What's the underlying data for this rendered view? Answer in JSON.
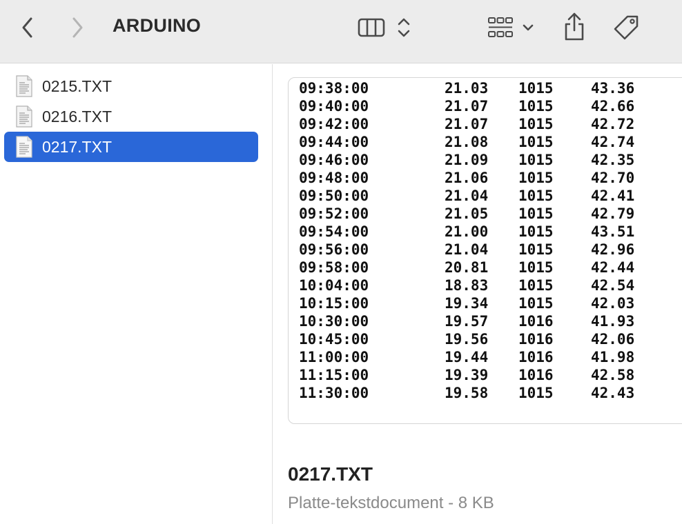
{
  "window": {
    "title": "ARDUINO"
  },
  "toolbar": {
    "icons": [
      "chevron-left-icon",
      "chevron-right-icon",
      "column-view-icon",
      "updown-chevron-icon",
      "grid-icon",
      "chevron-down-icon",
      "share-icon",
      "tag-icon"
    ]
  },
  "sidebar": {
    "files": [
      {
        "name": "0215.TXT",
        "selected": false
      },
      {
        "name": "0216.TXT",
        "selected": false
      },
      {
        "name": "0217.TXT",
        "selected": true
      }
    ]
  },
  "preview": {
    "rows": [
      {
        "time": "09:38:00",
        "temp": "21.03",
        "pressure": "1015",
        "humidity": "43.36"
      },
      {
        "time": "09:40:00",
        "temp": "21.07",
        "pressure": "1015",
        "humidity": "42.66"
      },
      {
        "time": "09:42:00",
        "temp": "21.07",
        "pressure": "1015",
        "humidity": "42.72"
      },
      {
        "time": "09:44:00",
        "temp": "21.08",
        "pressure": "1015",
        "humidity": "42.74"
      },
      {
        "time": "09:46:00",
        "temp": "21.09",
        "pressure": "1015",
        "humidity": "42.35"
      },
      {
        "time": "09:48:00",
        "temp": "21.06",
        "pressure": "1015",
        "humidity": "42.70"
      },
      {
        "time": "09:50:00",
        "temp": "21.04",
        "pressure": "1015",
        "humidity": "42.41"
      },
      {
        "time": "09:52:00",
        "temp": "21.05",
        "pressure": "1015",
        "humidity": "42.79"
      },
      {
        "time": "09:54:00",
        "temp": "21.00",
        "pressure": "1015",
        "humidity": "43.51"
      },
      {
        "time": "09:56:00",
        "temp": "21.04",
        "pressure": "1015",
        "humidity": "42.96"
      },
      {
        "time": "09:58:00",
        "temp": "20.81",
        "pressure": "1015",
        "humidity": "42.44"
      },
      {
        "time": "10:04:00",
        "temp": "18.83",
        "pressure": "1015",
        "humidity": "42.54"
      },
      {
        "time": "10:15:00",
        "temp": "19.34",
        "pressure": "1015",
        "humidity": "42.03"
      },
      {
        "time": "10:30:00",
        "temp": "19.57",
        "pressure": "1016",
        "humidity": "41.93"
      },
      {
        "time": "10:45:00",
        "temp": "19.56",
        "pressure": "1016",
        "humidity": "42.06"
      },
      {
        "time": "11:00:00",
        "temp": "19.44",
        "pressure": "1016",
        "humidity": "41.98"
      },
      {
        "time": "11:15:00",
        "temp": "19.39",
        "pressure": "1016",
        "humidity": "42.58"
      },
      {
        "time": "11:30:00",
        "temp": "19.58",
        "pressure": "1015",
        "humidity": "42.43"
      }
    ]
  },
  "info": {
    "file_name": "0217.TXT",
    "file_meta": "Platte-tekstdocument - 8 KB"
  },
  "colors": {
    "selection": "#2a67d8",
    "toolbar_bg": "#ececec"
  }
}
